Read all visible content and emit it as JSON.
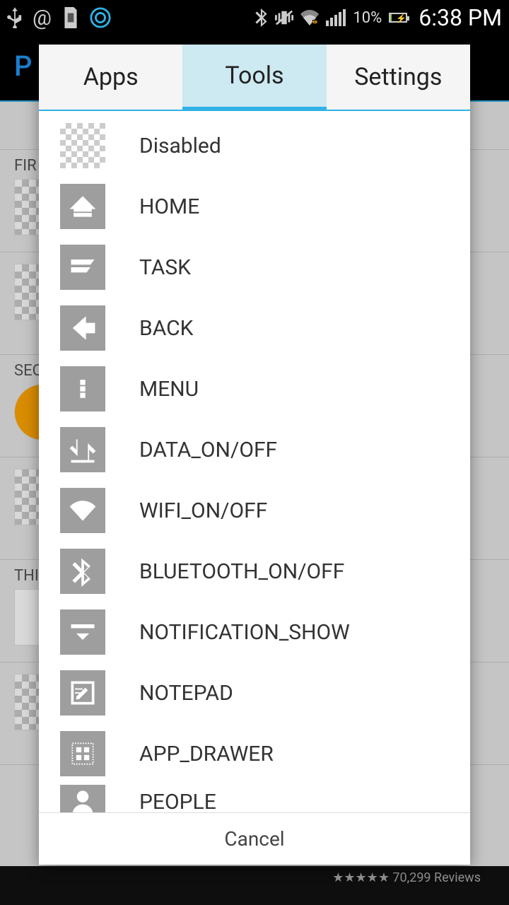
{
  "status": {
    "battery_pct": "10%",
    "time": "6:38 PM"
  },
  "background": {
    "app_title": "P",
    "section1": "FIR",
    "section2": "SEC",
    "section3": "THI",
    "ad_text": "70,299 Reviews"
  },
  "dialog": {
    "tabs": [
      {
        "label": "Apps",
        "active": false
      },
      {
        "label": "Tools",
        "active": true
      },
      {
        "label": "Settings",
        "active": false
      }
    ],
    "items": [
      {
        "label": "Disabled",
        "icon": "disabled"
      },
      {
        "label": "HOME",
        "icon": "home"
      },
      {
        "label": "TASK",
        "icon": "task"
      },
      {
        "label": "BACK",
        "icon": "back"
      },
      {
        "label": "MENU",
        "icon": "menu"
      },
      {
        "label": "DATA_ON/OFF",
        "icon": "data"
      },
      {
        "label": "WIFI_ON/OFF",
        "icon": "wifi"
      },
      {
        "label": "BLUETOOTH_ON/OFF",
        "icon": "bluetooth"
      },
      {
        "label": "NOTIFICATION_SHOW",
        "icon": "notification"
      },
      {
        "label": "NOTEPAD",
        "icon": "notepad"
      },
      {
        "label": "APP_DRAWER",
        "icon": "appdrawer"
      },
      {
        "label": "PEOPLE",
        "icon": "people"
      }
    ],
    "cancel": "Cancel"
  }
}
